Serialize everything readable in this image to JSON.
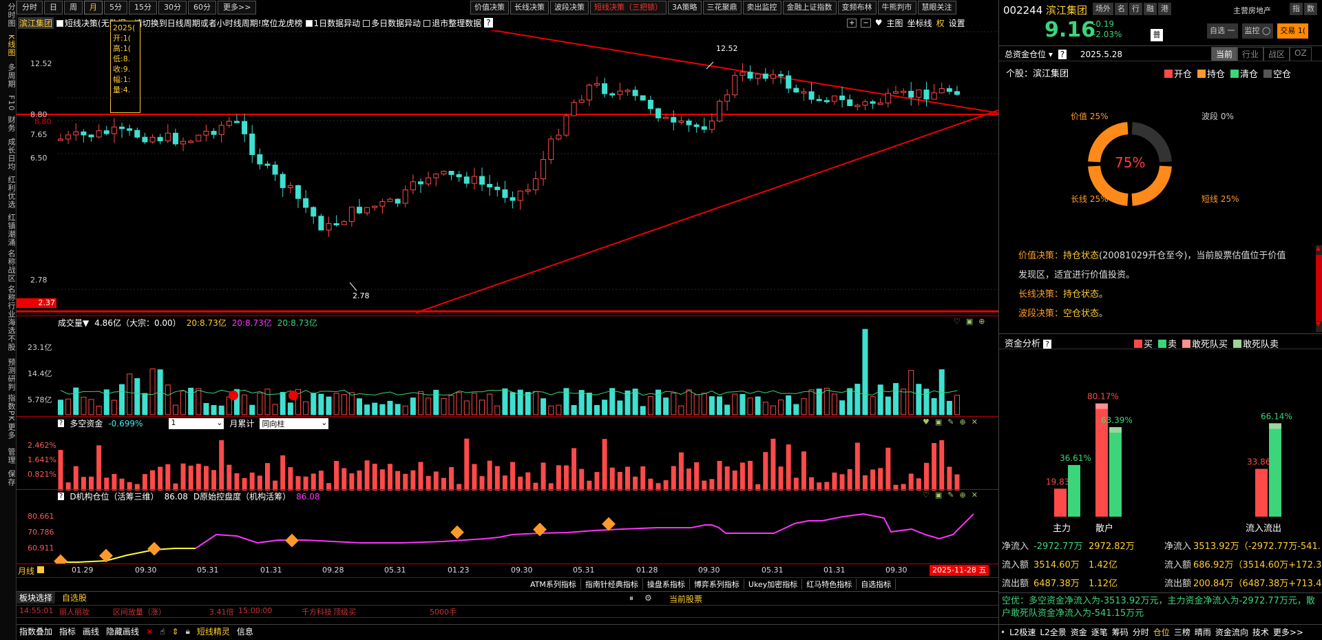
{
  "left_rail": [
    "分时图",
    "K线图",
    "多周期",
    "F10",
    "财务",
    "成长日均",
    "红利优选",
    "红镇潮涌",
    "名称战区",
    "名称行业",
    "海选不股",
    "预测研判",
    "指数PK",
    "更多",
    "管理",
    "保存"
  ],
  "period_tabs": [
    "分时",
    "日",
    "周",
    "月",
    "5分",
    "15分",
    "30分",
    "60分",
    "更多>>"
  ],
  "period_active": "月",
  "decision_tabs": [
    "价值决策",
    "长线决策",
    "波段决策",
    "短线决策（三把锁）",
    "3A策略",
    "三花聚鼎",
    "卖出监控",
    "金融上证指数",
    "变频布林",
    "牛熊判市",
    "慧眼关注"
  ],
  "chart_toolbar": {
    "stock_name": "滨江集团",
    "msg": "短线决策(无数据，请切换到日线周期或者小时线周期!",
    "dragon": "席位龙虎榜",
    "opt1": "1日数据异动",
    "opt2": "多日数据异动",
    "opt3": "退市整理数据",
    "right": [
      "主图",
      "坐标线",
      "权",
      "设置"
    ]
  },
  "tooltip": {
    "date": "2025(",
    "open": "开:1(",
    "high": "高:1(",
    "low": "低:8.",
    "close": "收:9.",
    "amp": "幅:1:",
    "vol": "量:4."
  },
  "price_axis": {
    "p1": "12.52",
    "p2": "8.80",
    "p3": "7.65",
    "p4": "6.50",
    "p5": "2.78",
    "p6": "2.37",
    "p2_red": "8.80"
  },
  "annotations": {
    "high": "12.52",
    "low": "2.78"
  },
  "volume_pane": {
    "title": "成交量▼",
    "value": "4.86亿（大宗：0.00）",
    "ma1": "20:8.73亿",
    "ma2": "20:8.73亿",
    "ma3": "20:8.73亿",
    "y1": "23.1亿",
    "y2": "14.4亿",
    "y3": "5.78亿"
  },
  "fund_pane": {
    "title": "多空资金",
    "value": "-0.699%",
    "sel1": "1",
    "lbl": "月累计",
    "sel2": "同向柱",
    "y1": "2.462%",
    "y2": "1.641%",
    "y3": "0.821%"
  },
  "inst_pane": {
    "title": "D机构仓位（活筹三维）",
    "value": "86.08",
    "title2": "D原始控盘度（机构活筹）",
    "value2": "86.08",
    "y1": "80.661",
    "y2": "70.786",
    "y3": "60.911"
  },
  "x_axis": {
    "label": "月线",
    "ticks": [
      "01.29",
      "09.30",
      "05.31",
      "01.31",
      "09.28",
      "05.31",
      "01.23",
      "09.30",
      "05.31",
      "01.28",
      "09.30",
      "05.31",
      "01.31",
      "09.30"
    ],
    "current": "2025-11-28 五"
  },
  "indicator_bar": [
    "ATM系列指标",
    "指南针经典指标",
    "操盘系指标",
    "博弈系列指标",
    "Ukey加密指标",
    "红马特色指标",
    "自选指标"
  ],
  "bottom": {
    "tab1": "板块选择",
    "tab2": "自选股",
    "cur": "当前股票",
    "time": "14:55:01",
    "n1": "丽人丽妆",
    "n2": "区间放量（涨）",
    "n3": "3.41倍",
    "n4": "15:00:00",
    "n5": "千方科技",
    "n6": "顶级买",
    "n7": "5000手",
    "tools": [
      "指数叠加",
      "指标",
      "画线",
      "隐藏画线"
    ],
    "ext": "短线精灵",
    "info": "信息",
    "status": [
      "L2极速",
      "L2全景",
      "资金",
      "逐笔",
      "筹码",
      "分时",
      "仓位",
      "三榜",
      "晴雨",
      "资金流向",
      "技术",
      "更多>>"
    ]
  },
  "right_panel": {
    "code": "002244",
    "name": "滨江集团",
    "tags": [
      "场外",
      "名",
      "行",
      "融",
      "港"
    ],
    "industry": "主营房地产",
    "btns": [
      "指",
      "数"
    ],
    "price": "9.16",
    "chg": "-0.19",
    "pct": "-2.03%",
    "badge": "普",
    "self": "自选 一",
    "monitor": "监控 ◯",
    "trade": "交易 1(",
    "pos_title": "总资金仓位",
    "help": "?",
    "date": "2025.5.28",
    "ptabs": [
      "当前",
      "行业",
      "战区",
      "OZ"
    ],
    "stock_lbl": "个股：滨江集团",
    "legend": [
      "开仓",
      "持仓",
      "清仓",
      "空仓"
    ],
    "donut": {
      "center": "75%",
      "value": "价值 25%",
      "band": "波段 0%",
      "long": "长线 25%",
      "short": "短线 25%"
    },
    "decisions": [
      {
        "k": "价值决策：",
        "v": "持仓状态",
        "rest": "(20081029开仓至今)，当前股票估值位于价值发现区，适宜进行价值投资。"
      },
      {
        "k": "长线决策：",
        "v": "持仓状态",
        "rest": "。"
      },
      {
        "k": "波段决策：",
        "v": "空仓状态",
        "rest": "。"
      }
    ],
    "fund_title": "资金分析",
    "fund_legend": [
      "买",
      "卖",
      "敢死队买",
      "敢死队卖"
    ],
    "bars": {
      "zl_buy": "19.83%",
      "zl_sell": "36.61%",
      "sh_buy": "80.17%",
      "sh_sell": "63.39%",
      "in_buy": "33.86%",
      "in_sell": "66.14%",
      "l1": "主力",
      "l2": "散户",
      "l3": "流入流出"
    },
    "stats": [
      {
        "k": "净流入",
        "a": "-2972.77万",
        "b": "2972.82万",
        "c": "净流入",
        "d": "3513.92万（-2972.77万-541.1"
      },
      {
        "k": "流入额",
        "a": "3514.60万",
        "b": "1.42亿",
        "c": "流入额",
        "d": "686.92万（3514.60万+172.32"
      },
      {
        "k": "流出额",
        "a": "6487.38万",
        "b": "1.12亿",
        "c": "流出额",
        "d": "200.84万（6487.38万+713.47"
      }
    ],
    "summary": "空优：多空资金净流入为-3513.92万元，主力资金净流入为-2972.77万元，散户敢死队资金净流入为-541.15万元"
  },
  "colors": {
    "up": "#ff4a4a",
    "down": "#3ee0d0",
    "accent": "#ffcc33",
    "trend": "#e00000"
  }
}
